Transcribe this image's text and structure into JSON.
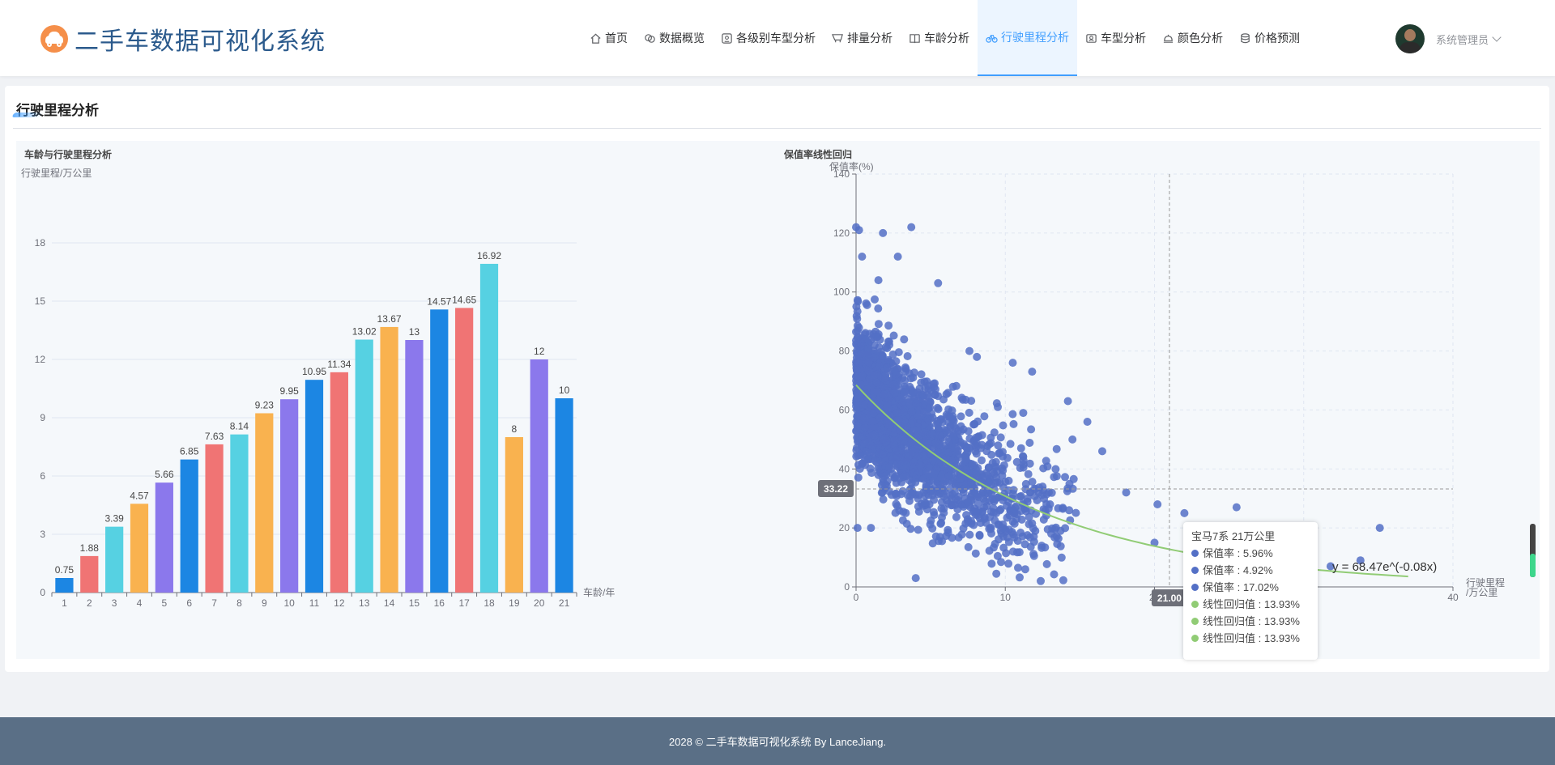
{
  "app": {
    "title": "二手车数据可视化系统"
  },
  "nav": {
    "items": [
      {
        "label": "首页",
        "icon": "home-icon"
      },
      {
        "label": "数据概览",
        "icon": "layers-icon"
      },
      {
        "label": "各级别车型分析",
        "icon": "badge-icon"
      },
      {
        "label": "排量分析",
        "icon": "cart-icon"
      },
      {
        "label": "车龄分析",
        "icon": "book-icon"
      },
      {
        "label": "行驶里程分析",
        "icon": "bicycle-icon",
        "active": true
      },
      {
        "label": "车型分析",
        "icon": "id-card-icon"
      },
      {
        "label": "颜色分析",
        "icon": "bell-icon"
      },
      {
        "label": "价格预测",
        "icon": "coins-icon"
      }
    ]
  },
  "user": {
    "name": "系统管理员"
  },
  "page": {
    "section_title": "行驶里程分析"
  },
  "left_chart": {
    "title": "车龄与行驶里程分析",
    "chart_data": {
      "type": "bar",
      "ylabel": "行驶里程/万公里",
      "xlabel": "车龄/年",
      "ylim": [
        0,
        18
      ],
      "yticks": [
        "0",
        "3",
        "6",
        "9",
        "12",
        "15",
        "18"
      ],
      "categories": [
        "1",
        "2",
        "3",
        "4",
        "5",
        "6",
        "7",
        "8",
        "9",
        "10",
        "11",
        "12",
        "13",
        "14",
        "15",
        "16",
        "17",
        "18",
        "19",
        "20",
        "21"
      ],
      "values": [
        0.75,
        1.88,
        3.39,
        4.57,
        5.66,
        6.85,
        7.63,
        8.14,
        9.23,
        9.95,
        10.95,
        11.34,
        13.02,
        13.67,
        13,
        14.57,
        14.65,
        16.92,
        8,
        12,
        10
      ],
      "labels": [
        "0.75",
        "1.88",
        "3.39",
        "4.57",
        "5.66",
        "6.85",
        "7.63",
        "8.14",
        "9.23",
        "9.95",
        "10.95",
        "11.34",
        "13.02",
        "13.67",
        "13",
        "14.57",
        "14.65",
        "16.92",
        "8",
        "12",
        "10"
      ],
      "palette": [
        "#1c86e3",
        "#f07474",
        "#56d1e2",
        "#f9b24f",
        "#8b78ec"
      ]
    }
  },
  "right_chart": {
    "title": "保值率线性回归",
    "chart_data": {
      "type": "scatter",
      "ylabel": "保值率(%)",
      "xlabel": "行驶里程/万公里",
      "xlim": [
        0,
        40
      ],
      "ylim": [
        0,
        140
      ],
      "xticks": [
        "0",
        "10",
        "20",
        "30",
        "40"
      ],
      "yticks": [
        "0",
        "20",
        "40",
        "60",
        "80",
        "100",
        "120",
        "140"
      ],
      "point_color": "#5470c6",
      "fit_color": "#91cc75",
      "fit": {
        "a": 68.47,
        "b": -0.08,
        "label": "y = 68.47e^(-0.08x)",
        "x_range": [
          0,
          37
        ]
      },
      "crosshair": {
        "x": 21.0,
        "y": 33.22,
        "x_label": "21.00",
        "y_label": "33.22"
      },
      "outliers": [
        [
          0.0,
          122
        ],
        [
          0.2,
          121
        ],
        [
          1.8,
          120
        ],
        [
          3.7,
          122
        ],
        [
          2.8,
          112
        ],
        [
          0.4,
          112
        ],
        [
          5.5,
          103
        ],
        [
          1.5,
          104
        ],
        [
          7.6,
          80
        ],
        [
          8.1,
          78
        ],
        [
          10.5,
          76
        ],
        [
          11.8,
          73
        ],
        [
          14.2,
          63
        ],
        [
          15.5,
          56
        ],
        [
          14.5,
          50
        ],
        [
          18.1,
          32
        ],
        [
          20.2,
          28
        ],
        [
          25.5,
          27
        ],
        [
          35.1,
          20
        ],
        [
          29.7,
          15
        ],
        [
          33.8,
          9
        ],
        [
          31.8,
          7
        ],
        [
          0.1,
          20
        ],
        [
          1.0,
          20
        ],
        [
          4.0,
          3
        ],
        [
          16.5,
          46
        ],
        [
          13.0,
          28
        ],
        [
          20.0,
          15
        ],
        [
          9.5,
          61
        ],
        [
          11.2,
          59
        ],
        [
          26.0,
          14
        ],
        [
          23.5,
          20
        ],
        [
          27.2,
          12
        ],
        [
          22.0,
          25
        ],
        [
          12.5,
          34
        ]
      ]
    }
  },
  "tooltip": {
    "title": "宝马7系 21万公里",
    "rows": [
      {
        "text": "保值率 : 5.96%",
        "color": "#5470c6"
      },
      {
        "text": "保值率 : 4.92%",
        "color": "#5470c6"
      },
      {
        "text": "保值率 : 17.02%",
        "color": "#5470c6"
      },
      {
        "text": "线性回归值 : 13.93%",
        "color": "#91cc75"
      },
      {
        "text": "线性回归值 : 13.93%",
        "color": "#91cc75"
      },
      {
        "text": "线性回归值 : 13.93%",
        "color": "#91cc75"
      }
    ]
  },
  "footer": {
    "text": "2028 © 二手车数据可视化系统 By LanceJiang."
  }
}
